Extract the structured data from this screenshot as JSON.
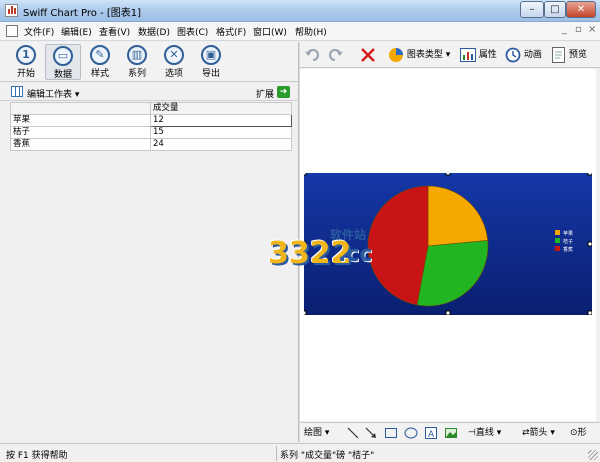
{
  "window": {
    "title": "Swiff Chart Pro - [图表1]",
    "minimize": "–",
    "maximize": "□",
    "close": "✕"
  },
  "menu": {
    "items": [
      "文件(F)",
      "编辑(E)",
      "查看(V)",
      "数据(D)",
      "图表(C)",
      "格式(F)",
      "窗口(W)",
      "帮助(H)"
    ],
    "right_controls": [
      "_",
      "▫",
      "×"
    ]
  },
  "left_toolbar": {
    "buttons": [
      {
        "label": "开始",
        "icon": "step-one-icon",
        "glyph": "1"
      },
      {
        "label": "数据",
        "icon": "data-icon",
        "glyph": "▭",
        "active": true
      },
      {
        "label": "样式",
        "icon": "style-brush-icon",
        "glyph": "✎"
      },
      {
        "label": "系列",
        "icon": "series-bars-icon",
        "glyph": "▥"
      },
      {
        "label": "选项",
        "icon": "options-tools-icon",
        "glyph": "✕"
      },
      {
        "label": "导出",
        "icon": "export-disk-icon",
        "glyph": "▣"
      }
    ]
  },
  "worksheet": {
    "title": "编辑工作表",
    "dropdown": "▾",
    "expand_label": "扩展",
    "header": [
      "",
      "成交量"
    ],
    "rows": [
      {
        "name": "苹果",
        "value": "12"
      },
      {
        "name": "桔子",
        "value": "15"
      },
      {
        "name": "香蕉",
        "value": "24"
      }
    ]
  },
  "right_toolbar": {
    "chart_type_label": "图表类型",
    "properties_label": "属性",
    "animation_label": "动画",
    "preview_label": "预览"
  },
  "chart_data": {
    "type": "pie",
    "categories": [
      "苹果",
      "桔子",
      "香蕉"
    ],
    "series": [
      {
        "name": "成交量",
        "values": [
          12,
          15,
          24
        ]
      }
    ],
    "colors": [
      "#f5a800",
      "#22b522",
      "#c81414"
    ],
    "legend": {
      "position": "right",
      "entries": [
        "苹果",
        "桔子",
        "香蕉"
      ]
    },
    "background": "blue-gradient",
    "title": "",
    "xlabel": "",
    "ylabel": ""
  },
  "draw_toolbar": {
    "draw_label": "绘图",
    "line_label": "直线",
    "arrow_label": "箭头",
    "shape_label": "形"
  },
  "status": {
    "help_text": "按 F1 获得帮助",
    "selection_text": "系列 \"成交量\"磅 \"桔子\""
  },
  "watermark": {
    "logo_number": "3322",
    "logo_domain": ".cc",
    "logo_text": "软件站"
  }
}
